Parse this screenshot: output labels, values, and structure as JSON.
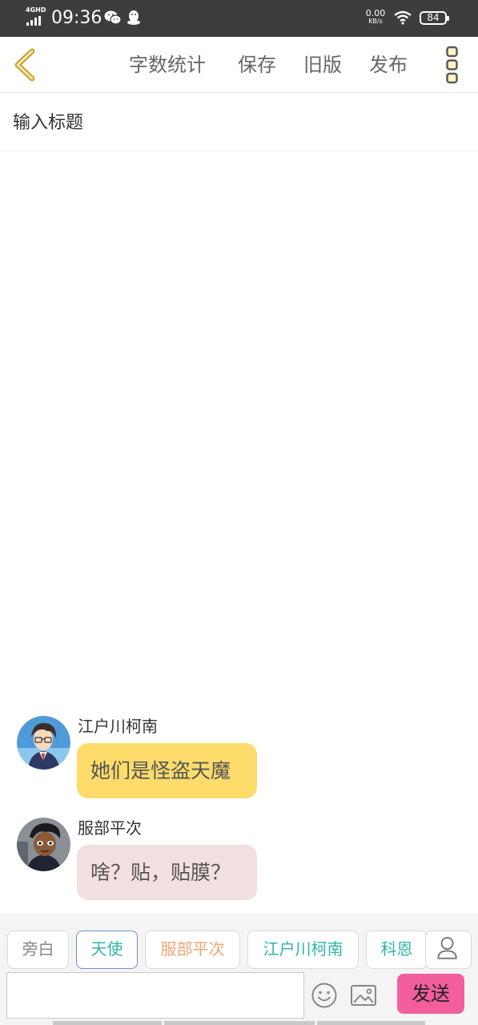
{
  "status_bar": {
    "network": "4GHD",
    "time": "09:36",
    "speed_value": "0.00",
    "speed_unit": "KB/s",
    "battery": "84"
  },
  "header": {
    "back_icon": "chevron-left-icon",
    "word_count_label": "字数统计",
    "save_label": "保存",
    "old_version_label": "旧版",
    "publish_label": "发布",
    "more_icon": "more-vertical-icon"
  },
  "title_input": {
    "placeholder": "输入标题",
    "value": ""
  },
  "messages": [
    {
      "sender": "江户川柯南",
      "text": "她们是怪盗天魔",
      "bubble_color": "#fddc6b",
      "avatar_icon": "character-avatar"
    },
    {
      "sender": "服部平次",
      "text": "啥？贴，贴膜？",
      "bubble_color": "#f2dfdf",
      "avatar_icon": "character-avatar"
    }
  ],
  "roles": [
    {
      "label": "旁白",
      "color": "#888888",
      "active": false
    },
    {
      "label": "天使",
      "color": "#2fb5a8",
      "active": true
    },
    {
      "label": "服部平次",
      "color": "#f0a56e",
      "active": false
    },
    {
      "label": "江户川柯南",
      "color": "#2fb5a8",
      "active": false
    },
    {
      "label": "科恩",
      "color": "#2fb5a8",
      "active": false
    }
  ],
  "composer": {
    "input_value": "",
    "emoji_icon": "smiley-icon",
    "image_icon": "image-icon",
    "user_icon": "user-icon",
    "send_label": "发送"
  },
  "colors": {
    "accent_yellow": "#fddc6b",
    "icon_gold": "#c9a93a",
    "send_pink": "#f25f9c",
    "status_bar_bg": "#3d3d3d"
  }
}
